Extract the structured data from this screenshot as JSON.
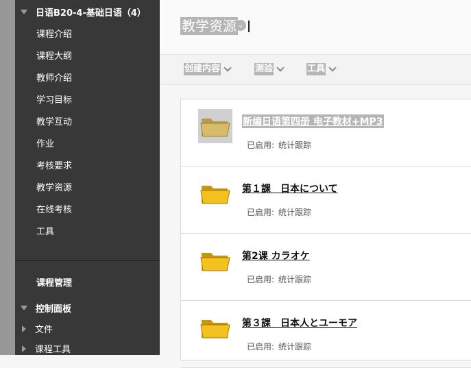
{
  "sidebar": {
    "course_title": "日语B20-4-基础日语（4）",
    "items": [
      "课程介绍",
      "课程大纲",
      "教师介绍",
      "学习目标",
      "教学互动",
      "作业",
      "考核要求",
      "教学资源",
      "在线考核",
      "工具"
    ],
    "management": "课程管理",
    "control_panel": "控制面板",
    "sub_items": [
      "文件",
      "课程工具"
    ]
  },
  "header": {
    "title": "教学资源"
  },
  "toolbar": {
    "create": "创建内容",
    "test": "测验",
    "tools": "工具"
  },
  "content": {
    "items": [
      {
        "title": "新编日语第四册 电子教材+MP3",
        "label": "已启用:",
        "value": "统计跟踪"
      },
      {
        "title": "第１課　日本について",
        "label": "已启用:",
        "value": "统计跟踪"
      },
      {
        "title": "第2课 カラオケ",
        "label": "已启用:",
        "value": "统计跟踪"
      },
      {
        "title": "第３課　日本人とユーモア",
        "label": "已启用:",
        "value": "统计跟踪"
      }
    ]
  },
  "icons": {
    "folder": "folder-icon",
    "expand": "triangle-down-icon",
    "collapsed": "triangle-right-icon",
    "chevron": "chevron-down-icon"
  },
  "colors": {
    "sidebar_bg": "#383838",
    "selection_gray": "#b5b5b5",
    "folder_yellow": "#f4c21f"
  }
}
